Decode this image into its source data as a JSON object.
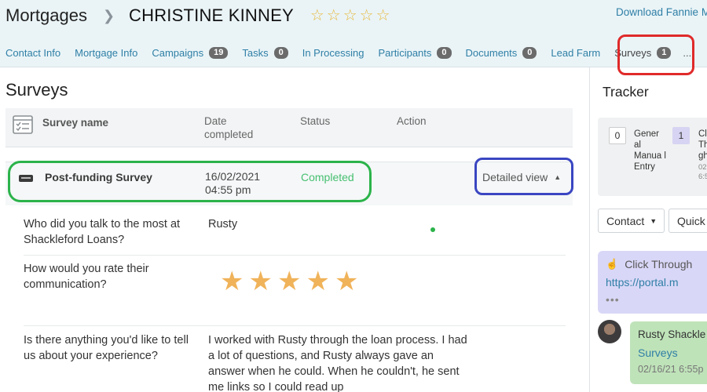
{
  "header": {
    "breadcrumb_root": "Mortgages",
    "breadcrumb_separator": ">",
    "client_name": "CHRISTINE KINNEY",
    "rating": {
      "value": 0,
      "max": 5
    },
    "download_link": "Download Fannie M",
    "star_color": "#e7b83c"
  },
  "tabs": [
    {
      "label": "Contact Info"
    },
    {
      "label": "Mortgage Info"
    },
    {
      "label": "Campaigns",
      "badge": "19"
    },
    {
      "label": "Tasks",
      "badge": "0"
    },
    {
      "label": "In Processing"
    },
    {
      "label": "Participants",
      "badge": "0"
    },
    {
      "label": "Documents",
      "badge": "0"
    },
    {
      "label": "Lead Farm"
    },
    {
      "label": "Surveys",
      "badge": "1",
      "active": true
    }
  ],
  "tabs_more": "...",
  "main": {
    "title": "Surveys",
    "columns": {
      "name": "Survey name",
      "date_line1": "Date",
      "date_line2": "completed",
      "status": "Status",
      "action": "Action"
    },
    "survey": {
      "name": "Post-funding Survey",
      "date": "16/02/2021",
      "time": "04:55 pm",
      "status": "Completed",
      "status_color": "#47c071",
      "action": "Detailed view"
    },
    "questions": [
      {
        "question": "Who did you talk to the most at Shackleford Loans?",
        "answer": "Rusty"
      },
      {
        "question": "How would you rate their communication?",
        "rating": 5,
        "rating_max": 5,
        "star_color": "#f0b35a"
      },
      {
        "question": "Is there anything you'd like to tell us about your experience?",
        "answer": "I worked with Rusty through the loan process. I had a lot of questions, and Rusty always gave an answer when he could. When he couldn't, he sent me links so I could read up"
      }
    ]
  },
  "tracker": {
    "title": "Tracker",
    "summary": [
      {
        "count": "0",
        "label": "Gener al Manua l Entry"
      },
      {
        "count": "1",
        "label": "Cl Th gh",
        "sub": "02 6:5"
      }
    ],
    "buttons": {
      "contact": "Contact",
      "quick": "Quick A"
    },
    "click_through": {
      "title": "Click Through",
      "link": "https://portal.m",
      "more": "•••",
      "color": "#d9d7f7"
    },
    "survey_event": {
      "name": "Rusty Shackle",
      "link": "Surveys",
      "time": "02/16/21 6:55p",
      "color": "#bfe3b9"
    }
  }
}
